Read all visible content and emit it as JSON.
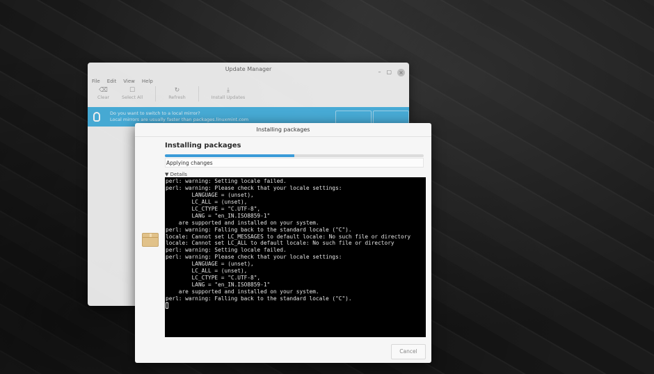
{
  "update_manager": {
    "title": "Update Manager",
    "window_controls": {
      "minimize": "–",
      "maximize": "▢",
      "close": "×"
    },
    "menu": [
      "File",
      "Edit",
      "View",
      "Help"
    ],
    "toolbar": [
      {
        "label": "Clear",
        "icon": "eraser-icon"
      },
      {
        "label": "Select All",
        "icon": "select-all-icon"
      },
      {
        "label": "Refresh",
        "icon": "refresh-icon"
      },
      {
        "label": "Install Updates",
        "icon": "download-icon"
      }
    ],
    "banner": {
      "line1": "Do you want to switch to a local mirror?",
      "line2": "Local mirrors are usually faster than packages.linuxmint.com",
      "color": "#4ab4e2"
    }
  },
  "dialog": {
    "title": "Installing packages",
    "heading": "Installing packages",
    "progress_fraction": 0.5,
    "status": "Applying changes",
    "details_label": "Details",
    "terminal_lines": [
      "perl: warning: Setting locale failed.",
      "perl: warning: Please check that your locale settings:",
      "        LANGUAGE = (unset),",
      "        LC_ALL = (unset),",
      "        LC_CTYPE = \"C.UTF-8\",",
      "        LANG = \"en_IN.ISO8859-1\"",
      "    are supported and installed on your system.",
      "perl: warning: Falling back to the standard locale (\"C\").",
      "locale: Cannot set LC_MESSAGES to default locale: No such file or directory",
      "locale: Cannot set LC_ALL to default locale: No such file or directory",
      "perl: warning: Setting locale failed.",
      "perl: warning: Please check that your locale settings:",
      "        LANGUAGE = (unset),",
      "        LC_ALL = (unset),",
      "        LC_CTYPE = \"C.UTF-8\",",
      "        LANG = \"en_IN.ISO8859-1\"",
      "    are supported and installed on your system.",
      "perl: warning: Falling back to the standard locale (\"C\")."
    ],
    "cancel_label": "Cancel",
    "accent_color": "#3a9bd8"
  }
}
